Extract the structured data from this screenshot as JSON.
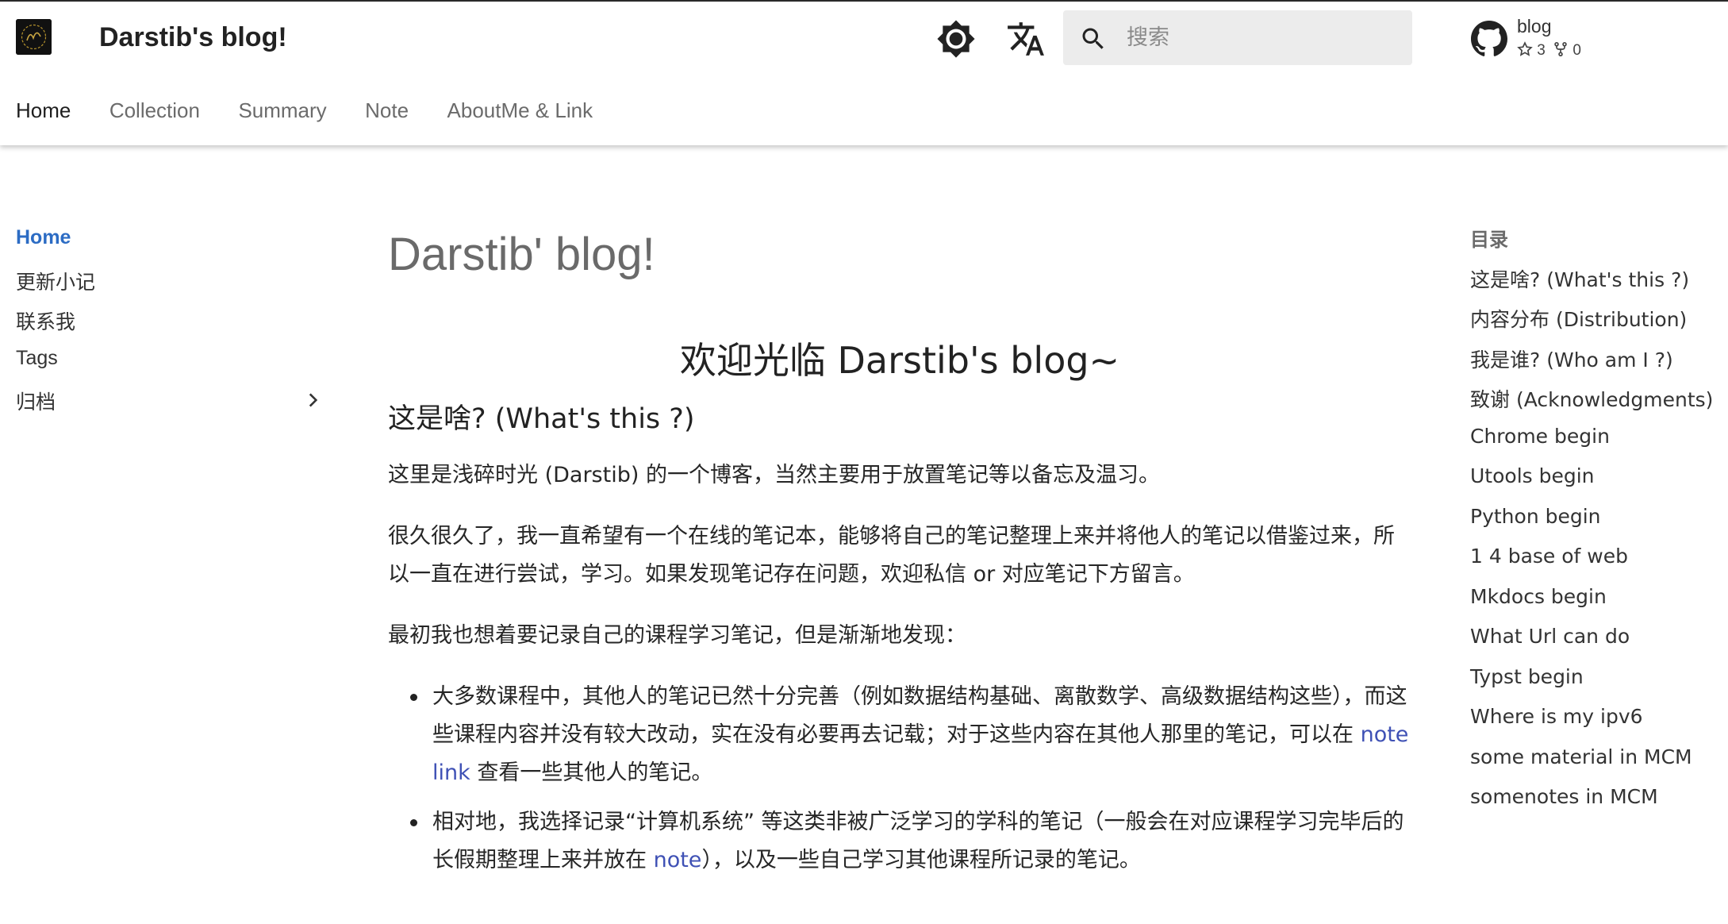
{
  "header": {
    "site_title": "Darstib's blog!",
    "search_placeholder": "搜索",
    "repo": {
      "name": "blog",
      "stars": "3",
      "forks": "0"
    }
  },
  "tabs": [
    {
      "label": "Home",
      "active": true
    },
    {
      "label": "Collection"
    },
    {
      "label": "Summary"
    },
    {
      "label": "Note"
    },
    {
      "label": "AboutMe & Link"
    }
  ],
  "sidebar": {
    "items": [
      {
        "label": "Home",
        "active": true
      },
      {
        "label": "更新小记"
      },
      {
        "label": "联系我"
      },
      {
        "label": "Tags"
      },
      {
        "label": "归档",
        "expandable": true
      }
    ]
  },
  "content": {
    "title": "Darstib' blog!",
    "welcome": "欢迎光临 Darstib's blog~",
    "section1_heading": "这是啥? (What's this ?)",
    "p1": "这里是浅碎时光 (Darstib) 的一个博客，当然主要用于放置笔记等以备忘及温习。",
    "p2": "很久很久了，我一直希望有一个在线的笔记本，能够将自己的笔记整理上来并将他人的笔记以借鉴过来，所以一直在进行尝试，学习。如果发现笔记存在问题，欢迎私信 or 对应笔记下方留言。",
    "p3": "最初我也想着要记录自己的课程学习笔记，但是渐渐地发现：",
    "bullet1_before": "大多数课程中，其他人的笔记已然十分完善（例如数据结构基础、离散数学、高级数据结构这些），而这些课程内容并没有较大改动，实在没有必要再去记载；对于这些内容在其他人那里的笔记，可以在 ",
    "bullet1_link": "note link",
    "bullet1_after": " 查看一些其他人的笔记。",
    "bullet2_before": "相对地，我选择记录“计算机系统” 等这类非被广泛学习的学科的笔记（一般会在对应课程学习完毕后的长假期整理上来并放在 ",
    "bullet2_link": "note",
    "bullet2_after": "），以及一些自己学习其他课程所记录的笔记。"
  },
  "toc": {
    "title": "目录",
    "items": [
      "这是啥? (What's this ?)",
      "内容分布 (Distribution)",
      "我是谁? (Who am I ?)",
      "致谢 (Acknowledgments)",
      "Chrome begin",
      "Utools begin",
      "Python begin",
      "1 4 base of web",
      "Mkdocs begin",
      "What Url can do",
      "Typst begin",
      "Where is my ipv6",
      "some material in MCM",
      "somenotes in MCM"
    ]
  },
  "colors": {
    "accent": "#2c6cc4",
    "link": "#3f51b5",
    "search_bg": "#ececec",
    "muted_title": "#6a6a6a"
  },
  "icons": {
    "logo": "site-logo",
    "theme": "brightness-icon",
    "language": "translate-icon",
    "search": "search-icon",
    "github": "github-icon",
    "star": "star-icon",
    "fork": "fork-icon",
    "chevron": "chevron-right-icon"
  }
}
